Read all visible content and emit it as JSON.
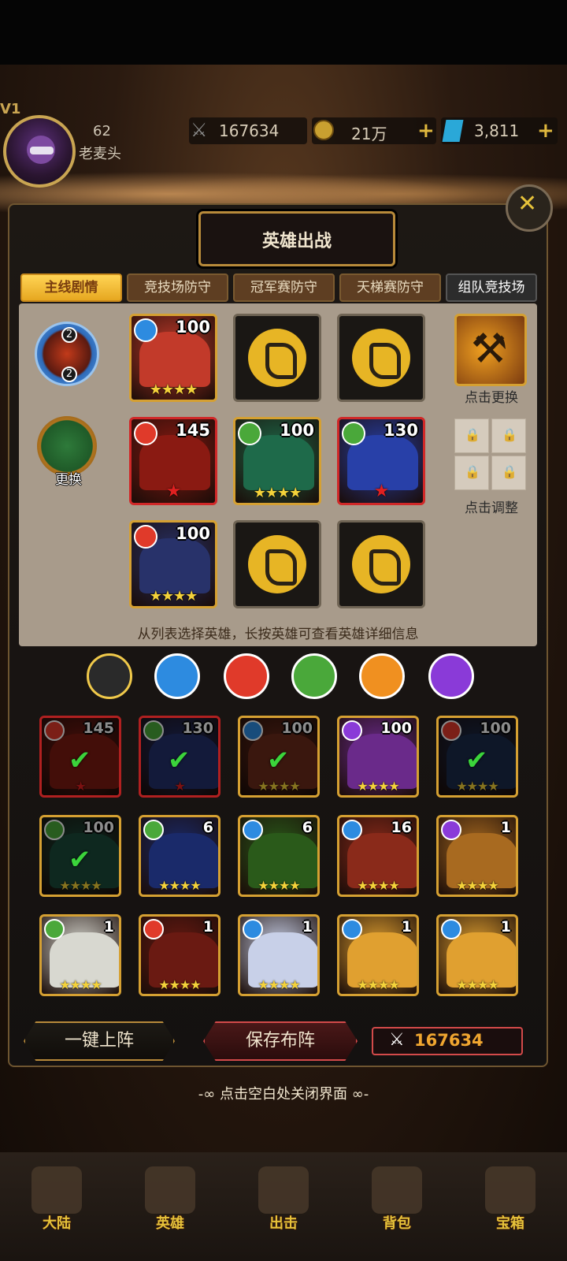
{
  "player": {
    "lv_label": "V1",
    "level": "62",
    "name": "老麦头"
  },
  "resources": {
    "power": "167634",
    "gold": "21万",
    "gems": "3,811",
    "plus": "+"
  },
  "panel": {
    "title": "英雄出战"
  },
  "tabs": [
    "主线剧情",
    "竞技场防守",
    "冠军赛防守",
    "天梯赛防守",
    "组队竞技场"
  ],
  "formation": {
    "buff_badges": [
      "2",
      "2"
    ],
    "swap_label": "更换",
    "weapon_label": "点击更换",
    "lock_label": "点击调整",
    "hint": "从列表选择英雄，长按英雄可查看英雄详细信息",
    "slots": [
      {
        "row": 0,
        "hero": true,
        "level": "100",
        "element": "water",
        "stars": "★★★★",
        "art": "#c23a2a"
      },
      {
        "row": 0,
        "hero": false
      },
      {
        "row": 0,
        "hero": false
      },
      {
        "row": 1,
        "hero": true,
        "level": "145",
        "element": "fire",
        "stars": "★",
        "art": "#8a1a12",
        "frame": "red"
      },
      {
        "row": 1,
        "hero": true,
        "level": "100",
        "element": "wood",
        "stars": "★★★★",
        "art": "#1e6a4a"
      },
      {
        "row": 1,
        "hero": true,
        "level": "130",
        "element": "wood",
        "stars": "★",
        "art": "#2840a8",
        "frame": "red"
      },
      {
        "row": 2,
        "hero": true,
        "level": "100",
        "element": "fire",
        "stars": "★★★★",
        "art": "#28326a"
      },
      {
        "row": 2,
        "hero": false
      },
      {
        "row": 2,
        "hero": false
      }
    ]
  },
  "filters": [
    "all",
    "water",
    "fire",
    "wood",
    "sun",
    "dark"
  ],
  "roster": [
    {
      "level": "145",
      "element": "fire",
      "stars": "★",
      "frame": "red",
      "in_team": true,
      "art": "#7a1a12"
    },
    {
      "level": "130",
      "element": "wood",
      "stars": "★",
      "frame": "red",
      "in_team": true,
      "art": "#23306a"
    },
    {
      "level": "100",
      "element": "water",
      "stars": "★★★★",
      "frame": "gold",
      "in_team": true,
      "art": "#6a2a1a"
    },
    {
      "level": "100",
      "element": "dark",
      "stars": "★★★★",
      "frame": "gold",
      "in_team": false,
      "art": "#6a2a8a"
    },
    {
      "level": "100",
      "element": "fire",
      "stars": "★★★★",
      "frame": "gold",
      "in_team": true,
      "art": "#1a2a4a"
    },
    {
      "level": "100",
      "element": "wood",
      "stars": "★★★★",
      "frame": "gold",
      "in_team": true,
      "art": "#1a4a3a"
    },
    {
      "level": "6",
      "element": "wood",
      "stars": "★★★★",
      "frame": "gold",
      "in_team": false,
      "art": "#1a2a6a"
    },
    {
      "level": "6",
      "element": "water",
      "stars": "★★★★",
      "frame": "gold",
      "in_team": false,
      "art": "#2a5a1a"
    },
    {
      "level": "16",
      "element": "water",
      "stars": "★★★★",
      "frame": "gold",
      "in_team": false,
      "art": "#8a2a1a"
    },
    {
      "level": "1",
      "element": "dark",
      "stars": "★★★★",
      "frame": "gold",
      "in_team": false,
      "art": "#a86a20"
    },
    {
      "level": "1",
      "element": "wood",
      "stars": "★★★★",
      "frame": "gold",
      "in_team": false,
      "art": "#d8d8d0"
    },
    {
      "level": "1",
      "element": "fire",
      "stars": "★★★★",
      "frame": "gold",
      "in_team": false,
      "art": "#6a1a12"
    },
    {
      "level": "1",
      "element": "water",
      "stars": "★★★★",
      "frame": "gold",
      "in_team": false,
      "art": "#c8d0e8"
    },
    {
      "level": "1",
      "element": "water",
      "stars": "★★★★",
      "frame": "gold",
      "in_team": false,
      "art": "#e0a030"
    },
    {
      "level": "1",
      "element": "water",
      "stars": "★★★★",
      "frame": "gold",
      "in_team": false,
      "art": "#e0a030"
    }
  ],
  "buttons": {
    "auto": "一键上阵",
    "save": "保存布阵",
    "power_value": "167634"
  },
  "close_hint": "-∞ 点击空白处关闭界面 ∞-",
  "nav": [
    "大陆",
    "英雄",
    "出击",
    "背包",
    "宝箱"
  ],
  "colors": {
    "gold": "#e6c23a",
    "accent": "#d5a032",
    "check": "#3bd43b"
  }
}
